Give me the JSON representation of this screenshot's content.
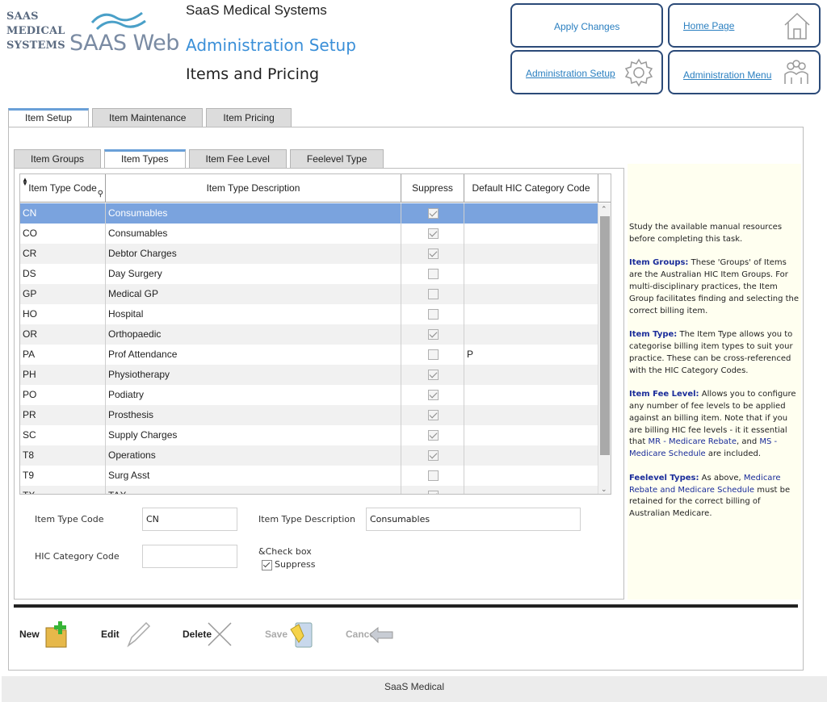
{
  "logo": {
    "small_lines": [
      "SAAS",
      "MEDICAL",
      "SYSTEMS"
    ],
    "big": "SAAS Web"
  },
  "header": {
    "company": "SaaS Medical Systems",
    "section": "Administration Setup",
    "page_title": "Items and Pricing"
  },
  "nav": {
    "apply": "Apply Changes",
    "home": "Home Page",
    "admin_setup": "Administration Setup",
    "admin_menu": "Administration Menu"
  },
  "main_tabs": [
    "Item Setup",
    "Item Maintenance",
    "Item Pricing"
  ],
  "sub_tabs": [
    "Item Groups",
    "Item Types",
    "Item Fee Level",
    "Feelevel Type"
  ],
  "grid": {
    "columns": [
      "Item Type Code",
      "Item Type Description",
      "Suppress",
      "Default HIC Category Code"
    ],
    "rows": [
      {
        "code": "CN",
        "desc": "Consumables",
        "suppress": true,
        "hic": ""
      },
      {
        "code": "CO",
        "desc": "Consumables",
        "suppress": true,
        "hic": ""
      },
      {
        "code": "CR",
        "desc": "Debtor Charges",
        "suppress": true,
        "hic": ""
      },
      {
        "code": "DS",
        "desc": "Day Surgery",
        "suppress": false,
        "hic": ""
      },
      {
        "code": "GP",
        "desc": "Medical GP",
        "suppress": false,
        "hic": ""
      },
      {
        "code": "HO",
        "desc": "Hospital",
        "suppress": false,
        "hic": ""
      },
      {
        "code": "OR",
        "desc": "Orthopaedic",
        "suppress": true,
        "hic": ""
      },
      {
        "code": "PA",
        "desc": "Prof Attendance",
        "suppress": false,
        "hic": "P"
      },
      {
        "code": "PH",
        "desc": "Physiotherapy",
        "suppress": true,
        "hic": ""
      },
      {
        "code": "PO",
        "desc": "Podiatry",
        "suppress": true,
        "hic": ""
      },
      {
        "code": "PR",
        "desc": "Prosthesis",
        "suppress": true,
        "hic": ""
      },
      {
        "code": "SC",
        "desc": "Supply Charges",
        "suppress": true,
        "hic": ""
      },
      {
        "code": "T8",
        "desc": "Operations",
        "suppress": true,
        "hic": ""
      },
      {
        "code": "T9",
        "desc": "Surg Asst",
        "suppress": false,
        "hic": ""
      },
      {
        "code": "TX",
        "desc": "TAX",
        "suppress": true,
        "hic": ""
      }
    ],
    "selected_index": 0
  },
  "form": {
    "code_label": "Item Type Code",
    "code_value": "CN",
    "desc_label": "Item Type Description",
    "desc_value": "Consumables",
    "hic_label": "HIC Category Code",
    "hic_value": "",
    "checkbox_caption": "&Check box",
    "suppress_label": "Suppress",
    "suppress_checked": true
  },
  "help": {
    "intro": "Study the available manual resources before completing this task.",
    "groups_title": "Item Groups:",
    "groups_text": " These 'Groups' of Items are the Australian HIC Item Groups. For multi-disciplinary practices, the Item Group facilitates finding and selecting the correct billing item.",
    "type_title": "Item Type:",
    "type_text": " The Item Type allows you to categorise billing item types to suit your practice. These can be cross-referenced with the HIC Category Codes.",
    "fee_title": "Item Fee Level:",
    "fee_text_1": " Allows you to configure any number of fee levels to be applied against an billing item. Note that if you are billing HIC fee levels - it it essential that ",
    "fee_hl_1": "MR - Medicare Rebate",
    "fee_text_2": ", and ",
    "fee_hl_2": "MS - Medicare Schedule",
    "fee_text_3": " are included.",
    "feelevel_title": "Feelevel Types:",
    "feelevel_text_1": " As above, ",
    "feelevel_hl": "Medicare Rebate and Medicare Schedule",
    "feelevel_text_2": " must be retained for the correct billing of Australian Medicare."
  },
  "toolbar": {
    "new": "New",
    "edit": "Edit",
    "delete": "Delete",
    "save": "Save",
    "cancel": "Cancel"
  },
  "footer": "SaaS Medical"
}
